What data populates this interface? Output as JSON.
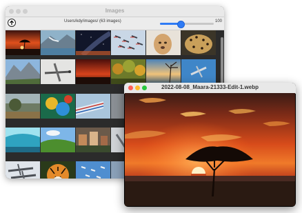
{
  "back_window": {
    "title": "Images",
    "path_label": "Users/kdy/images/  (63 images)",
    "thumbnail_size": "100",
    "thumbnail_size_fraction": 0.38
  },
  "front_window": {
    "title": "2022-08-08_Maara-21333-Edit-1.webp"
  },
  "thumbnails": [
    {
      "name": "thumb-sunset-tree",
      "subject": "sunset acacia tree"
    },
    {
      "name": "thumb-glacier",
      "subject": "glacier lake"
    },
    {
      "name": "thumb-milky-way",
      "subject": "night sky"
    },
    {
      "name": "thumb-jets-formation",
      "subject": "jets formation"
    },
    {
      "name": "thumb-dog",
      "subject": "dog"
    },
    {
      "name": "thumb-leopard",
      "subject": "leopard"
    },
    {
      "name": "thumb-mountains",
      "subject": "mountain valley"
    },
    {
      "name": "thumb-warplane",
      "subject": "warplane"
    },
    {
      "name": "thumb-red-sunset",
      "subject": "red sunset"
    },
    {
      "name": "thumb-autumn-forest",
      "subject": "autumn forest"
    },
    {
      "name": "thumb-beach-sunset",
      "subject": "beach sunset tree"
    },
    {
      "name": "thumb-jet-blue-sky",
      "subject": "jet in blue sky"
    },
    {
      "name": "thumb-painting-landscape",
      "subject": "landscape painting"
    },
    {
      "name": "thumb-colorful-abstract",
      "subject": "colorful abstract"
    },
    {
      "name": "thumb-jets-smoke",
      "subject": "jets with smoke"
    },
    {
      "name": "thumb-ice-cave",
      "subject": "ice cave"
    },
    {
      "name": "thumb-green-hills",
      "subject": "green hills"
    },
    {
      "name": "thumb-town",
      "subject": "town"
    },
    {
      "name": "thumb-fighter-jets",
      "subject": "fighter jets"
    },
    {
      "name": "thumb-tiger",
      "subject": "tiger"
    },
    {
      "name": "thumb-jets-blue",
      "subject": "jets in blue sky"
    }
  ]
}
